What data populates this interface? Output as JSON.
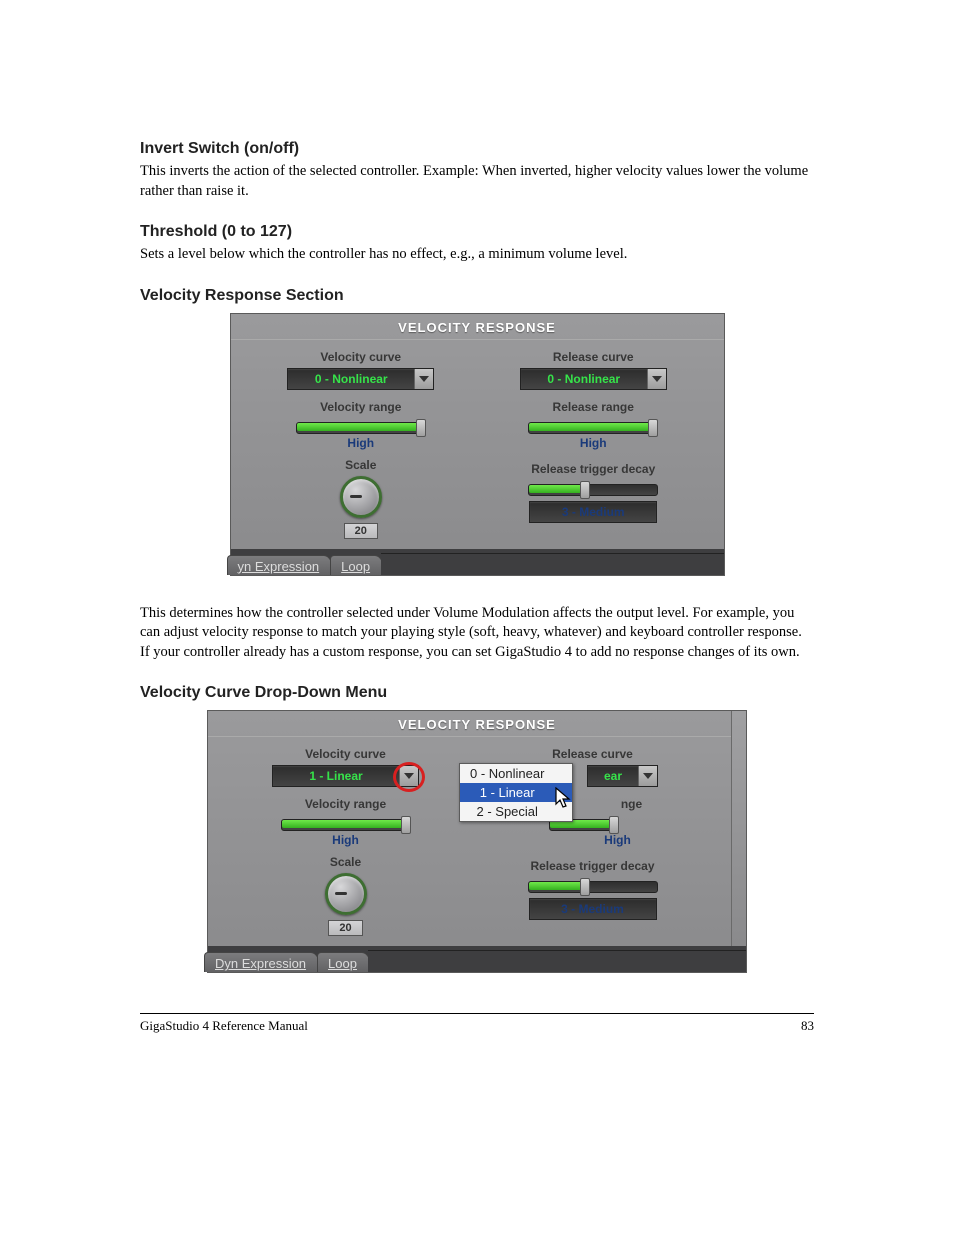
{
  "sections": {
    "invert": {
      "heading": "Invert Switch (on/off)",
      "body": "This inverts the action of the selected controller. Example: When inverted, higher velocity values lower the volume rather than raise it."
    },
    "threshold": {
      "heading": "Threshold (0 to 127)",
      "body": "Sets a level below which the controller has no effect, e.g., a minimum volume level."
    },
    "velresp": {
      "heading": "Velocity Response Section"
    },
    "velresp_body": "This determines how the controller selected under Volume Modulation affects the output level. For example, you can adjust velocity response to match your playing style (soft, heavy, whatever) and keyboard controller response. If your controller already has a custom response, you can set GigaStudio 4 to add no response changes of its own.",
    "velcurve": {
      "heading": "Velocity Curve Drop-Down Menu"
    }
  },
  "panel_a": {
    "title": "VELOCITY RESPONSE",
    "left": {
      "curve_label": "Velocity curve",
      "curve_value": "0 - Nonlinear",
      "range_label": "Velocity range",
      "range_value": "High",
      "scale_label": "Scale",
      "scale_value": "20"
    },
    "right": {
      "curve_label": "Release curve",
      "curve_value": "0 - Nonlinear",
      "range_label": "Release range",
      "range_value": "High",
      "trigger_label": "Release trigger decay",
      "trigger_value": "3 - Medium"
    },
    "tabs": {
      "a": "yn Expression",
      "b": "Loop"
    }
  },
  "panel_b": {
    "title": "VELOCITY RESPONSE",
    "left": {
      "curve_label": "Velocity curve",
      "curve_value": "1 - Linear",
      "range_label": "Velocity range",
      "range_value": "High",
      "scale_label": "Scale",
      "scale_value": "20"
    },
    "right": {
      "curve_label": "Release curve",
      "curve_value_partial": "ear",
      "range_label_partial": "nge",
      "range_value": "High",
      "trigger_label": "Release trigger decay",
      "trigger_value": "3 - Medium"
    },
    "popup": {
      "opt0": "0 - Nonlinear",
      "opt1": "1 - Linear",
      "opt2": "2 - Special"
    },
    "tabs": {
      "a": "Dyn Expression",
      "b": "Loop"
    }
  },
  "footer": {
    "left": "GigaStudio 4 Reference Manual",
    "right": "83"
  }
}
